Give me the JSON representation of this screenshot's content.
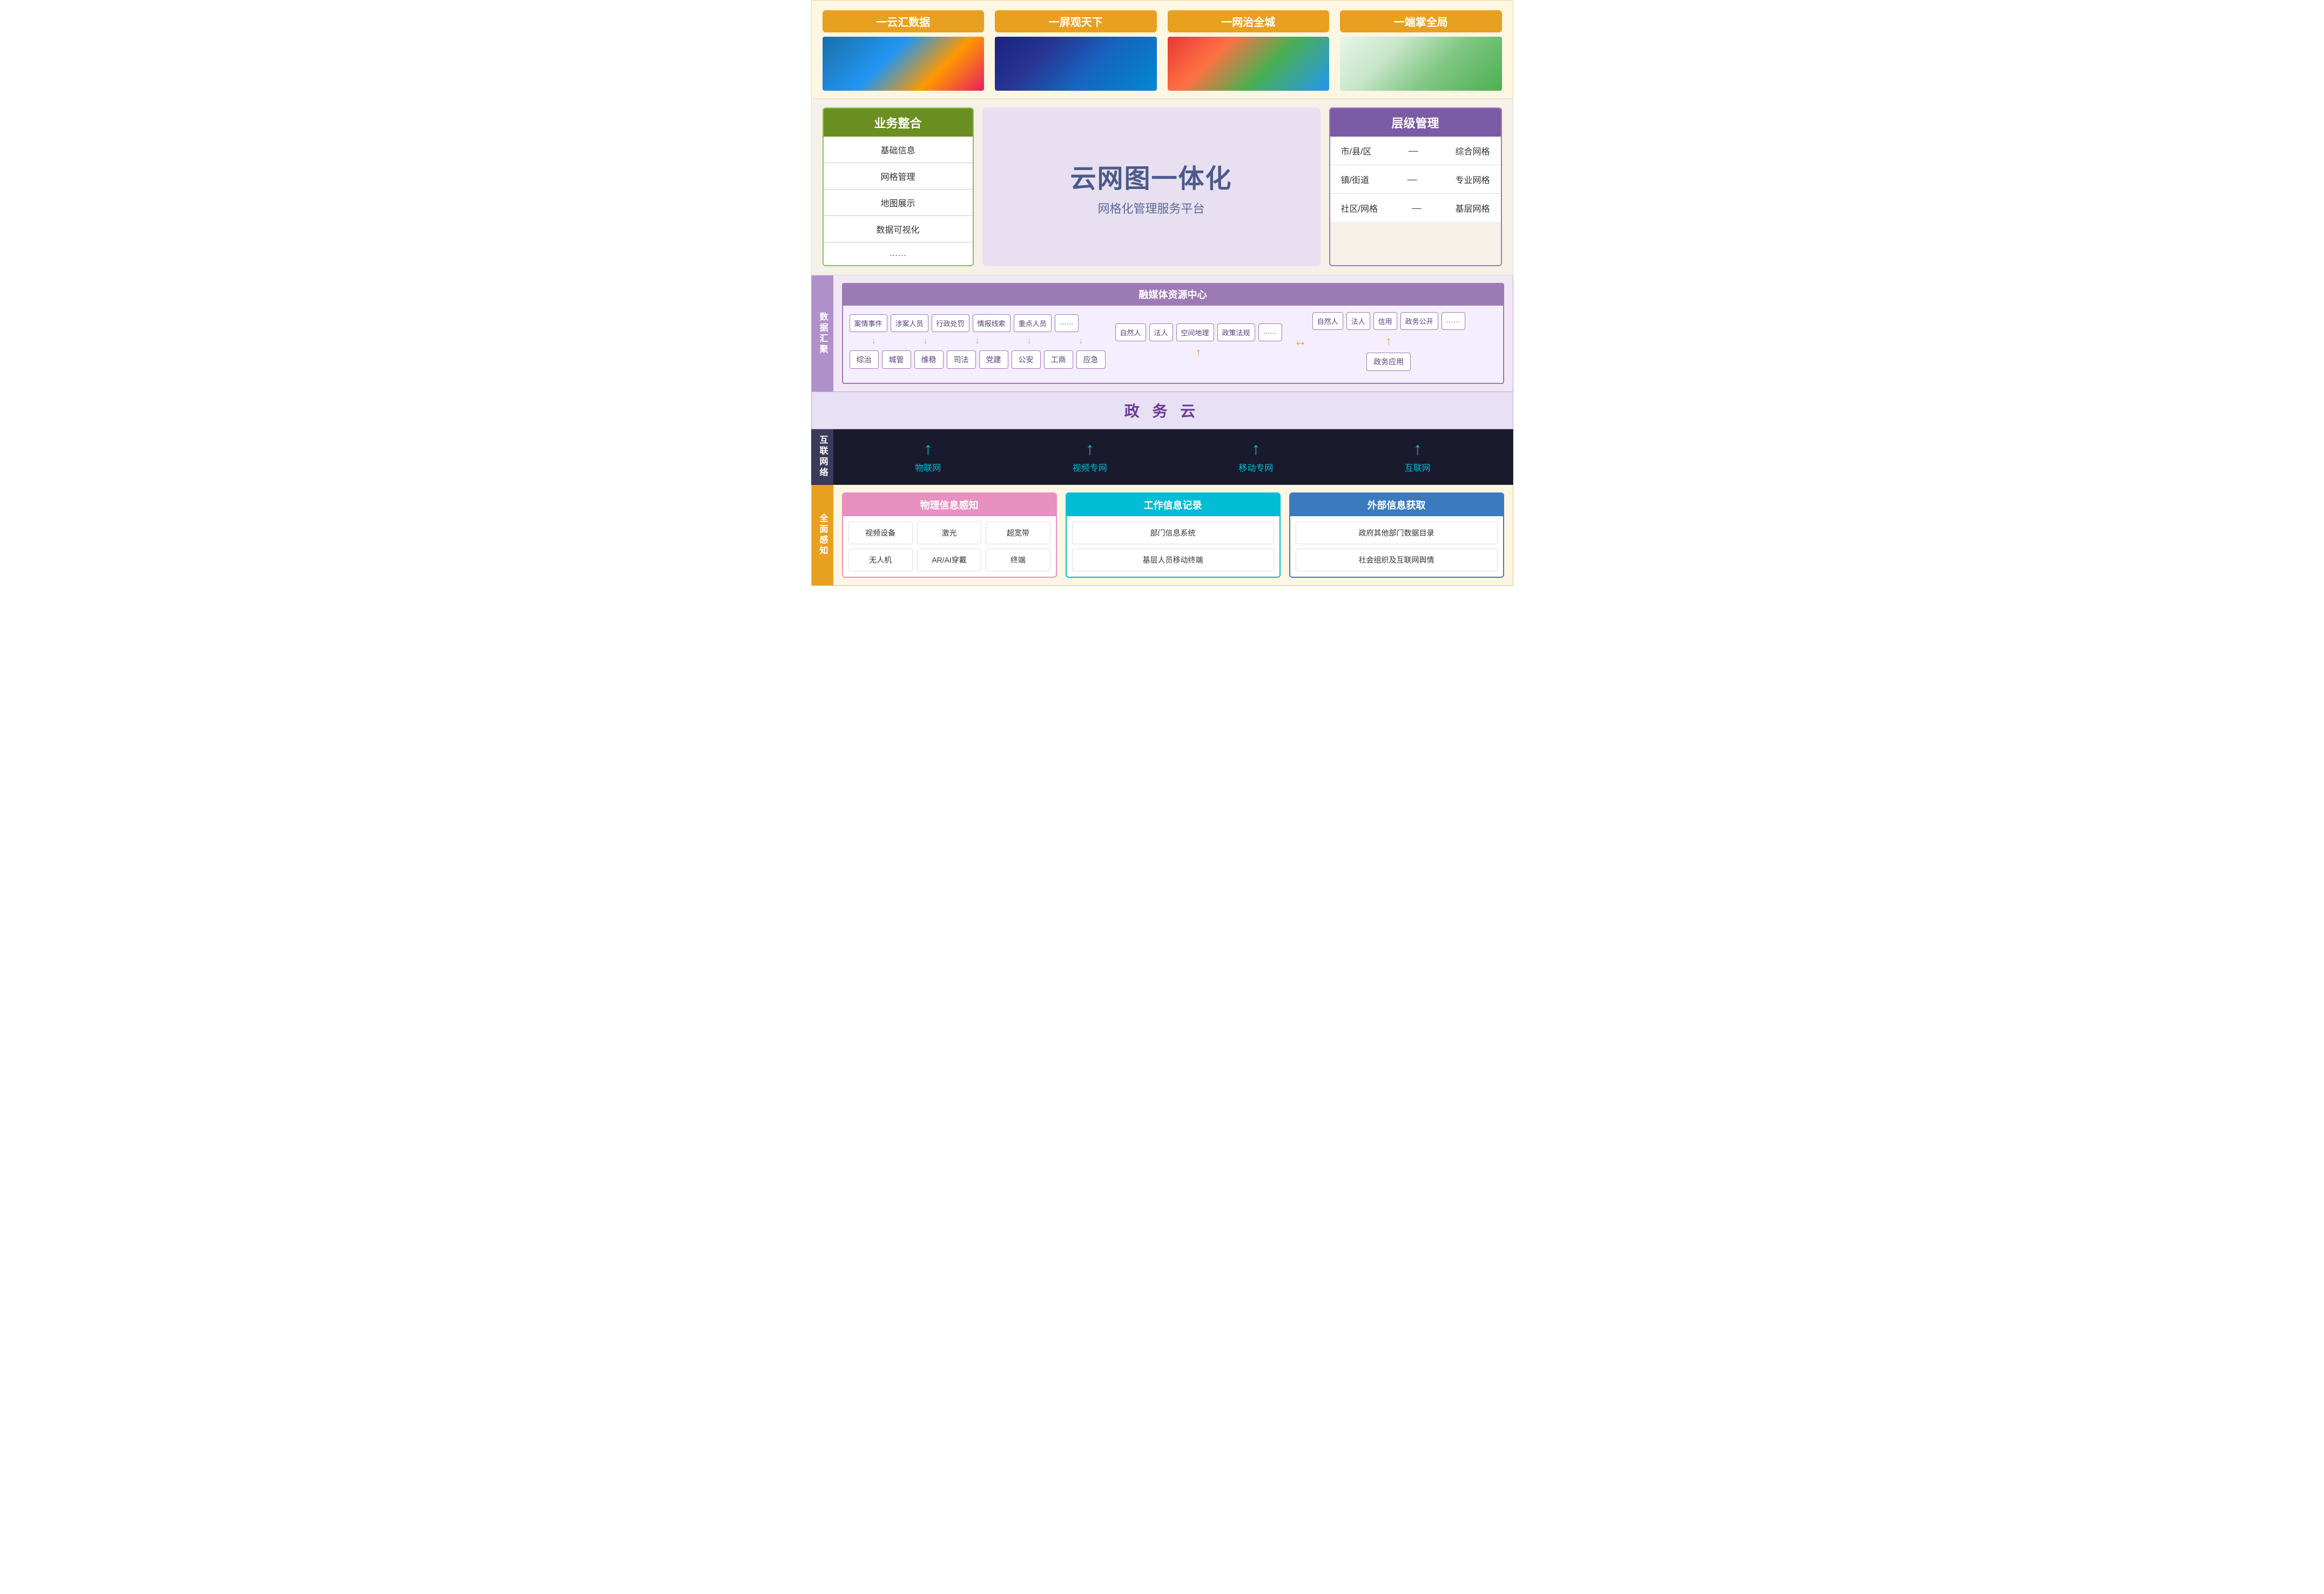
{
  "top": {
    "cards": [
      {
        "label": "一云汇数据",
        "img_class": "img-cloud"
      },
      {
        "label": "一屏观天下",
        "img_class": "img-screen"
      },
      {
        "label": "一网治全城",
        "img_class": "img-map"
      },
      {
        "label": "一端掌全局",
        "img_class": "img-mobile"
      }
    ]
  },
  "middle": {
    "biz_panel": {
      "header": "业务整合",
      "items": [
        "基础信息",
        "网格管理",
        "地图展示",
        "数据可视化",
        "……"
      ]
    },
    "center": {
      "title": "云网图一体化",
      "subtitle": "网格化管理服务平台"
    },
    "level_panel": {
      "header": "层级管理",
      "rows": [
        {
          "left": "市/县/区",
          "dash": "—",
          "right": "综合网格"
        },
        {
          "left": "镇/街道",
          "dash": "—",
          "right": "专业网格"
        },
        {
          "left": "社区/网格",
          "dash": "—",
          "right": "基层网格"
        }
      ]
    }
  },
  "data_aggregation": {
    "vertical_label": "数据汇聚",
    "media_center": {
      "header": "融媒体资源中心",
      "left_tags_row1": [
        "案情事件",
        "涉案人员",
        "行政处罚",
        "情报线索",
        "重点人员",
        "……"
      ],
      "middle_tags_row1": [
        "自然人",
        "法人",
        "空间地理",
        "政策法规",
        "……"
      ],
      "right_tags_row1": [
        "自然人",
        "法人",
        "信用",
        "政务公开",
        "……"
      ],
      "bottom_tags_left": [
        "综治",
        "城管",
        "维稳",
        "司法",
        "党建",
        "公安",
        "工商",
        "应急"
      ],
      "bottom_tags_right": [
        "政务应用"
      ]
    }
  },
  "gov_cloud": {
    "title": "政 务 云"
  },
  "network": {
    "vertical_label": "互联网络",
    "items": [
      "物联网",
      "视频专网",
      "移动专网",
      "互联网"
    ]
  },
  "perception": {
    "vertical_label": "全面感知",
    "physical": {
      "header": "物理信息感知",
      "grid": [
        "视频设备",
        "激光",
        "超宽带",
        "无人机",
        "AR/AI穿戴",
        "终端"
      ]
    },
    "work": {
      "header": "工作信息记录",
      "items": [
        "部门信息系统",
        "基层人员移动终端"
      ]
    },
    "external": {
      "header": "外部信息获取",
      "items": [
        "政府其他部门数据目录",
        "社会组织及互联网舆情"
      ]
    }
  }
}
